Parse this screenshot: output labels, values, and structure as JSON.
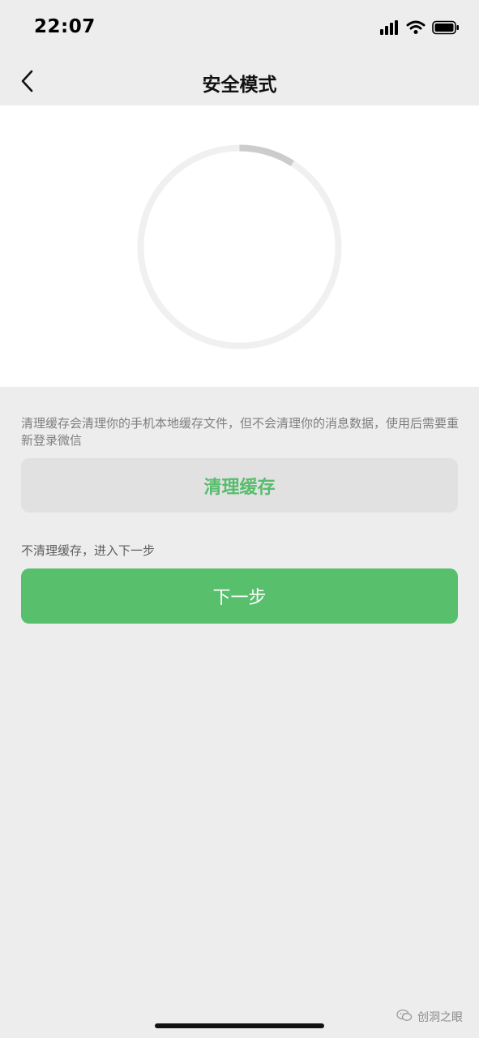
{
  "status_bar": {
    "time": "22:07",
    "icons": [
      "signal-icon",
      "wifi-icon",
      "battery-icon"
    ]
  },
  "nav": {
    "title": "安全模式",
    "back_icon": "chevron-left-icon"
  },
  "progress": {
    "value_fraction": 0.09,
    "track_color": "#f0f0f0",
    "indicator_color": "#cccccc"
  },
  "cache": {
    "description": "清理缓存会清理你的手机本地缓存文件，但不会清理你的消息数据，使用后需要重新登录微信",
    "clear_button_label": "清理缓存"
  },
  "skip": {
    "label": "不清理缓存，进入下一步",
    "next_button_label": "下一步"
  },
  "watermark": {
    "text": "创洞之眼",
    "icon": "wechat-icon"
  },
  "colors": {
    "accent_green": "#58bf6d",
    "accent_green_text": "#56bd6c",
    "page_background": "#ededed"
  }
}
